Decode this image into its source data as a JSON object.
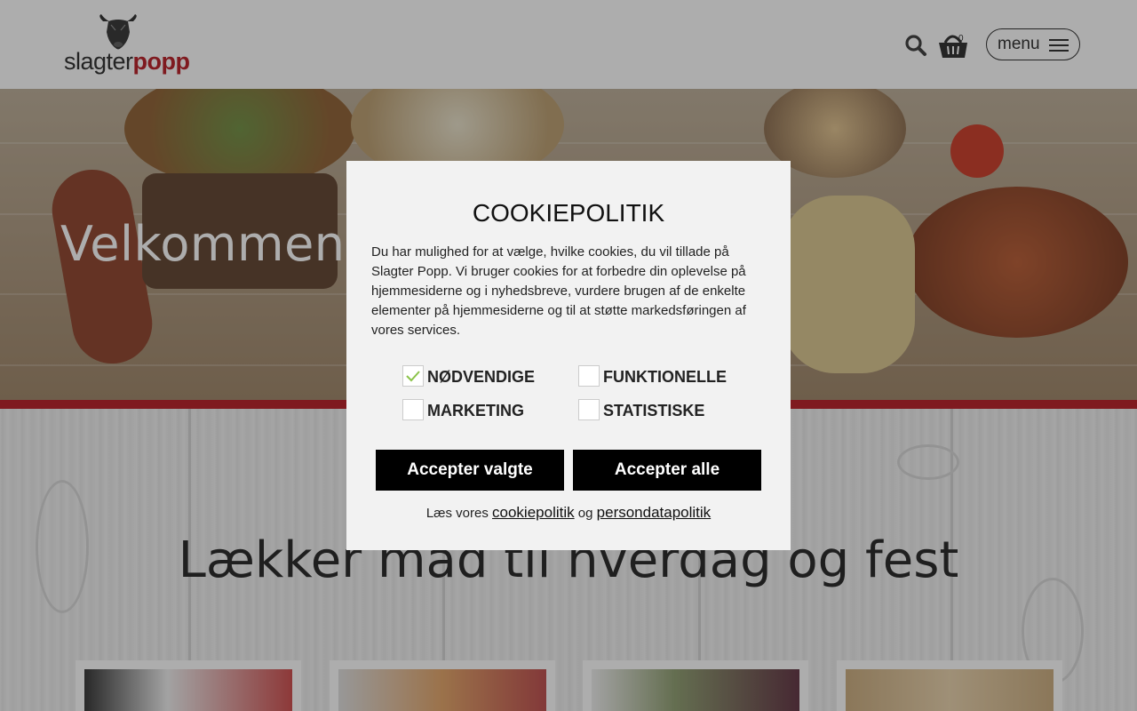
{
  "header": {
    "logo_text_slagter": "slagter",
    "logo_text_popp": "popp",
    "basket_count": "0",
    "menu_label": "menu"
  },
  "hero": {
    "title": "Velkommen t"
  },
  "section": {
    "title": "Lækker mad til hverdag og fest"
  },
  "cookie_dialog": {
    "title": "COOKIEPOLITIK",
    "text": "Du har mulighed for at vælge, hvilke cookies, du vil tillade på Slagter Popp. Vi bruger cookies for at forbedre din oplevelse på hjemmesiderne og i nyhedsbreve, vurdere brugen af de enkelte elementer på hjemmesiderne og til at støtte markedsføringen af vores services.",
    "options": [
      {
        "label": "NØDVENDIGE",
        "checked": true
      },
      {
        "label": "FUNKTIONELLE",
        "checked": false
      },
      {
        "label": "MARKETING",
        "checked": false
      },
      {
        "label": "STATISTISKE",
        "checked": false
      }
    ],
    "accept_selected_label": "Accepter valgte",
    "accept_all_label": "Accepter alle",
    "policy_prefix": "Læs vores",
    "cookie_link": "cookiepolitik",
    "policy_joiner": "og",
    "privacy_link": "persondatapolitik"
  },
  "colors": {
    "brand_red": "#b5121b",
    "button_black": "#000000",
    "check_green": "#8bc34a"
  }
}
